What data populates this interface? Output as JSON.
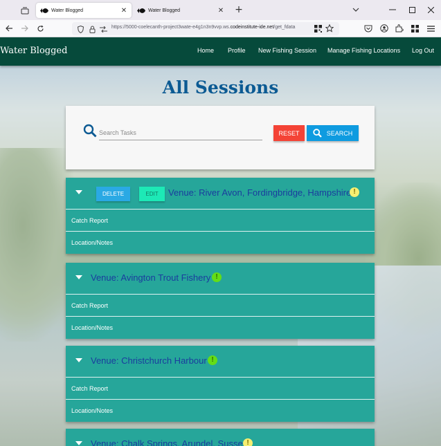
{
  "browser": {
    "tabs": [
      {
        "title": "Water Blogged",
        "active": true
      },
      {
        "title": "Water Blogged",
        "active": false
      }
    ],
    "url_prefix": "https://5000-coelecanth-project3wate-e4g1n3n9vvp.ws.",
    "url_domain": "codeinstitute-ide.net",
    "url_path": "/get_fdata"
  },
  "site": {
    "brand": "Water Blogged",
    "nav": {
      "home": "Home",
      "profile": "Profile",
      "new_session": "New Fishing Session",
      "manage_locations": "Manage Fishing Locations",
      "logout": "Log Out"
    },
    "header_color": "#064a3b"
  },
  "main": {
    "title": "All Sessions",
    "search": {
      "placeholder": "Search Tasks",
      "value": "",
      "reset_label": "RESET",
      "search_label": "SEARCH"
    },
    "sessions": [
      {
        "venue": "Venue: River Avon, Fordingbridge, Hampshire",
        "badge": "!",
        "badge_color": "#f6ef72",
        "delete_label": "DELETE",
        "edit_label": "EDIT",
        "rows": [
          "Catch Report",
          "Location/Notes"
        ]
      },
      {
        "venue": "Venue: Avington Trout Fishery",
        "badge": "!",
        "badge_color": "#64dd17",
        "rows": [
          "Catch Report",
          "Location/Notes"
        ]
      },
      {
        "venue": "Venue: Christchurch Harbour",
        "badge": "!",
        "badge_color": "#64dd17",
        "rows": [
          "Catch Report",
          "Location/Notes"
        ]
      },
      {
        "venue": "Venue: Chalk Springs, Arundel, Sussex",
        "badge": "!",
        "badge_color": "#f6ef72",
        "rows": []
      }
    ],
    "session_color": "#26a69a"
  }
}
